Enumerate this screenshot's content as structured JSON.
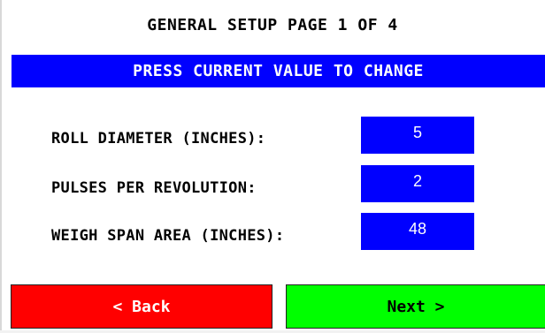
{
  "screen": {
    "title": "GENERAL SETUP PAGE 1 OF 4",
    "banner": "PRESS CURRENT VALUE TO CHANGE"
  },
  "settings": [
    {
      "label": "ROLL DIAMETER (INCHES):",
      "value": "5"
    },
    {
      "label": "PULSES PER REVOLUTION:",
      "value": "2"
    },
    {
      "label": "WEIGH SPAN AREA (INCHES):",
      "value": "48"
    }
  ],
  "navigation": {
    "back_label": "< Back",
    "next_label": "Next >"
  },
  "colors": {
    "banner": "#0000ff",
    "value_button": "#0000ff",
    "back_button": "#ff0000",
    "next_button": "#00ff00"
  }
}
